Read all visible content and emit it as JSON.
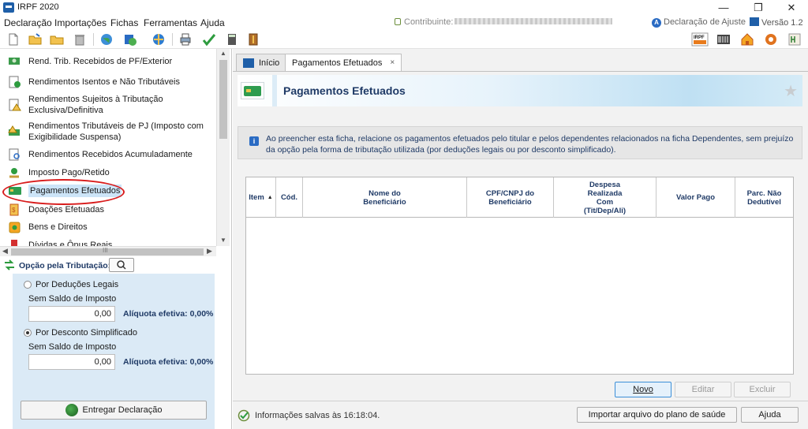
{
  "window": {
    "title": "IRPF 2020",
    "minimize": "—",
    "restore": "❐",
    "close": "✕"
  },
  "menu": {
    "items": [
      "Declaração",
      "Importações",
      "Fichas",
      "Ferramentas",
      "Ajuda"
    ],
    "contribuinte_label": "Contribuinte:",
    "declaracao_label": "Declaração de Ajuste",
    "declaracao_badge": "A",
    "versao": "Versão 1.2"
  },
  "toolbar": {
    "icons": [
      "new-file-icon",
      "open-folder-icon",
      "folder-icon",
      "trash-icon",
      "globe-icon",
      "book-globe-icon",
      "network-globe-icon",
      "printer-icon",
      "checkmark-icon",
      "calculator-icon",
      "archive-icon"
    ],
    "right_icons": [
      "irpf-logo-icon",
      "barcode-icon",
      "home-icon",
      "gear-icon",
      "hm-icon"
    ],
    "irpf_logo_text": "IRPF"
  },
  "sidebar": {
    "items": [
      {
        "label": "Rend. Trib. Recebidos de PF/Exterior",
        "icon": "money-person-icon"
      },
      {
        "label": "Rendimentos Isentos e Não Tributáveis",
        "icon": "document-check-icon"
      },
      {
        "label": "Rendimentos Sujeitos à Tributação Exclusiva/Definitiva",
        "icon": "warning-document-icon"
      },
      {
        "label": "Rendimentos Tributáveis de PJ (Imposto com Exigibilidade Suspensa)",
        "icon": "money-warning-icon"
      },
      {
        "label": "Rendimentos Recebidos Acumuladamente",
        "icon": "document-magnifier-icon"
      },
      {
        "label": "Imposto Pago/Retido",
        "icon": "coin-hand-icon"
      },
      {
        "label": "Pagamentos Efetuados",
        "icon": "credit-card-icon"
      },
      {
        "label": "Doações Efetuadas",
        "icon": "donation-icon"
      },
      {
        "label": "Bens e Direitos",
        "icon": "money-bag-icon"
      },
      {
        "label": "Dívidas e Ônus Reais",
        "icon": "debt-icon"
      }
    ],
    "selected_index": 6
  },
  "opcao": {
    "header": "Opção pela Tributação:",
    "deducoes": {
      "label": "Por Deduções Legais",
      "saldo_label": "Sem Saldo de Imposto",
      "value": "0,00",
      "aliquota": "Alíquota efetiva: 0,00%"
    },
    "simplificado": {
      "label": "Por Desconto Simplificado",
      "saldo_label": "Sem Saldo de Imposto",
      "value": "0,00",
      "aliquota": "Alíquota efetiva: 0,00%"
    },
    "selected": "simplificado",
    "entregar_label": "Entregar Declaração"
  },
  "tabs": [
    {
      "label": "Início",
      "active": false
    },
    {
      "label": "Pagamentos Efetuados",
      "active": true,
      "close": "×"
    }
  ],
  "main": {
    "title": "Pagamentos Efetuados",
    "info_text": "Ao preencher esta ficha, relacione os pagamentos efetuados pelo titular e pelos dependentes relacionados na ficha Dependentes, sem prejuízo da opção pela forma de tributação utilizada (por deduções legais ou por desconto simplificado).",
    "columns": [
      [
        "Item"
      ],
      [
        "Cód."
      ],
      [
        "Nome do",
        "Beneficiário"
      ],
      [
        "CPF/CNPJ do",
        "Beneficiário"
      ],
      [
        "Despesa",
        "Realizada",
        "Com",
        "(Tit/Dep/Ali)"
      ],
      [
        "Valor Pago"
      ],
      [
        "Parc. Não",
        "Dedutível"
      ]
    ],
    "rows": [],
    "buttons": {
      "novo": "Novo",
      "editar": "Editar",
      "excluir": "Excluir"
    },
    "import_button": "Importar arquivo do plano de saúde",
    "help_button": "Ajuda",
    "status_text": "Informações salvas às 16:18:04."
  }
}
